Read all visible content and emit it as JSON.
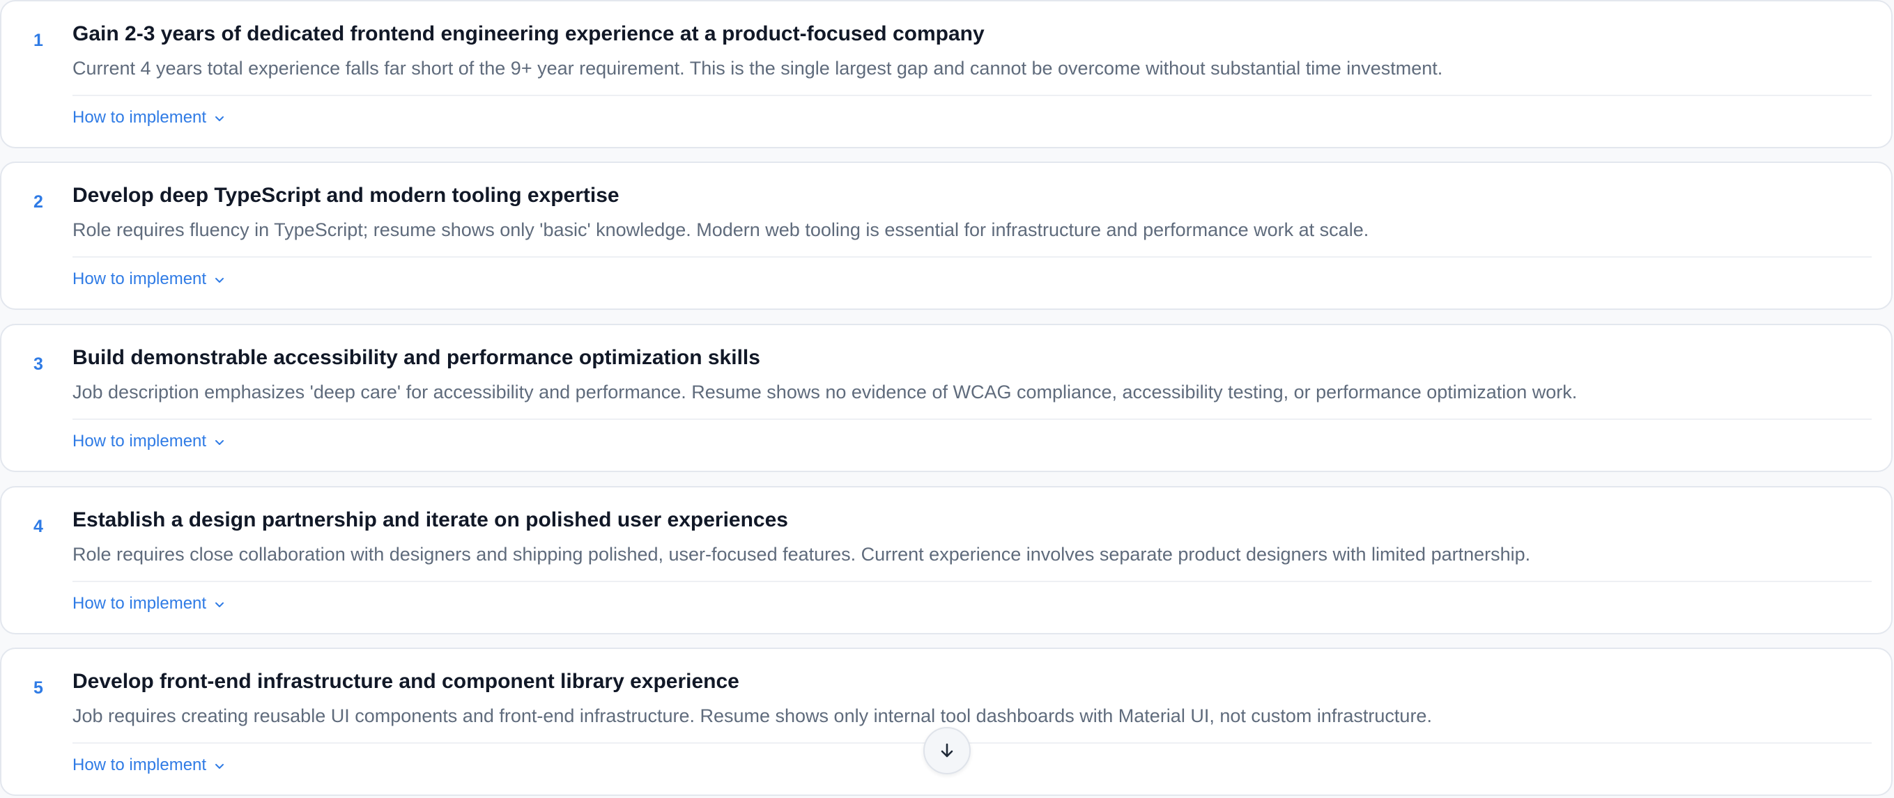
{
  "implement_label": "How to implement",
  "recommendations": [
    {
      "number": "1",
      "title": "Gain 2-3 years of dedicated frontend engineering experience at a product-focused company",
      "description": "Current 4 years total experience falls far short of the 9+ year requirement. This is the single largest gap and cannot be overcome without substantial time investment."
    },
    {
      "number": "2",
      "title": "Develop deep TypeScript and modern tooling expertise",
      "description": "Role requires fluency in TypeScript; resume shows only 'basic' knowledge. Modern web tooling is essential for infrastructure and performance work at scale."
    },
    {
      "number": "3",
      "title": "Build demonstrable accessibility and performance optimization skills",
      "description": "Job description emphasizes 'deep care' for accessibility and performance. Resume shows no evidence of WCAG compliance, accessibility testing, or performance optimization work."
    },
    {
      "number": "4",
      "title": "Establish a design partnership and iterate on polished user experiences",
      "description": "Role requires close collaboration with designers and shipping polished, user-focused features. Current experience involves separate product designers with limited partnership."
    },
    {
      "number": "5",
      "title": "Develop front-end infrastructure and component library experience",
      "description": "Job requires creating reusable UI components and front-end infrastructure. Resume shows only internal tool dashboards with Material UI, not custom infrastructure."
    }
  ],
  "icons": {
    "implement": "chevron-down-icon",
    "scroll": "arrow-down-icon"
  },
  "colors": {
    "accent": "#2f7be5",
    "title": "#111827",
    "description": "#5f6b7c",
    "card_border": "#e3e7ee",
    "background": "#f8f9fb"
  }
}
